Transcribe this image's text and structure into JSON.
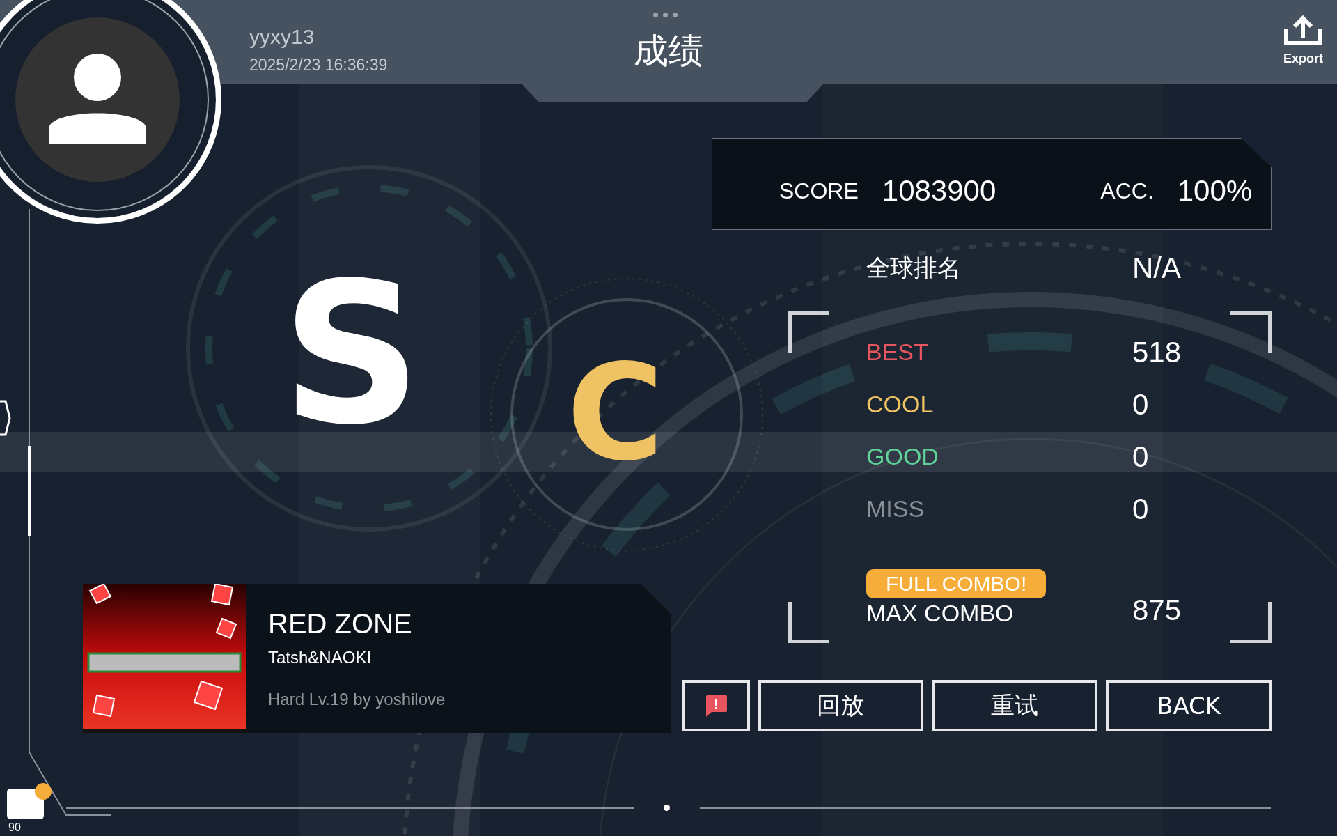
{
  "header": {
    "title": "成绩",
    "export_label": "Export"
  },
  "player": {
    "name": "yyxy13",
    "datetime": "2025/2/23 16:36:39"
  },
  "grade": [
    {
      "text": "S",
      "color": "#ffffff"
    },
    {
      "text": "C",
      "color": "#efc263"
    }
  ],
  "score": {
    "label": "SCORE",
    "value": "1083900",
    "acc_label": "ACC.",
    "acc_value": "100%"
  },
  "stats": [
    {
      "kind": "rank",
      "label": "全球排名",
      "value": "N/A"
    },
    {
      "kind": "judge",
      "label": "BEST",
      "value": "518",
      "color": "#e8555f"
    },
    {
      "kind": "judge",
      "label": "COOL",
      "value": "0",
      "color": "#efc263"
    },
    {
      "kind": "judge",
      "label": "GOOD",
      "value": "0",
      "color": "#5fd39a"
    },
    {
      "kind": "judge",
      "label": "MISS",
      "value": "0",
      "color": "#8a8f96"
    },
    {
      "kind": "combo",
      "label": "MAX COMBO",
      "value": "875",
      "badge": "FULL COMBO!"
    }
  ],
  "song": {
    "title": "RED ZONE",
    "artist": "Tatsh&NAOKI",
    "chart": "Hard Lv.19 by yoshilove"
  },
  "buttons": [
    {
      "kind": "icon"
    },
    {
      "kind": "text",
      "label": "回放"
    },
    {
      "kind": "text",
      "label": "重试"
    },
    {
      "kind": "text",
      "label": "BACK"
    }
  ],
  "chat": {
    "count": "90"
  }
}
